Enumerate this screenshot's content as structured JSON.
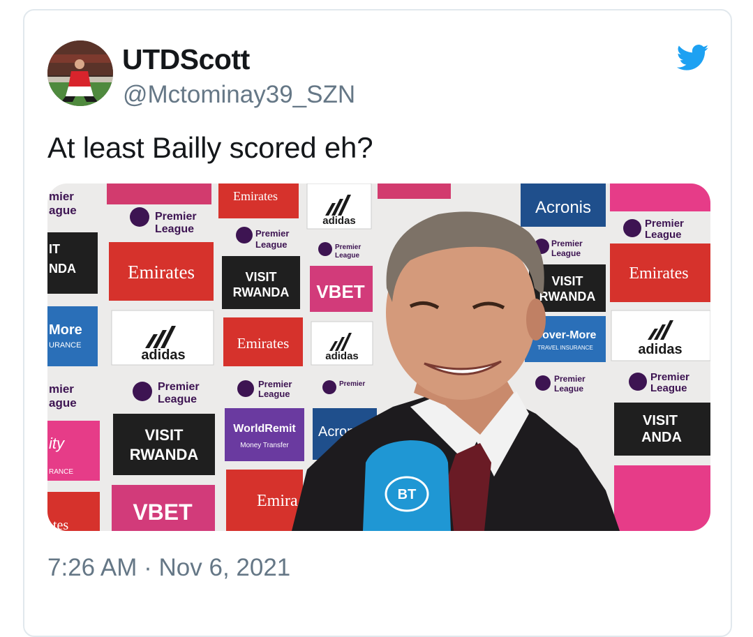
{
  "tweet": {
    "display_name": "UTDScott",
    "handle": "@Mctominay39_SZN",
    "text": "At least Bailly scored eh?",
    "timestamp": "7:26 AM · Nov 6, 2021"
  },
  "icons": {
    "logo": "twitter-bird-icon",
    "avatar": "profile-avatar",
    "brand_color": "#1da1f2"
  },
  "photo": {
    "board_texts": {
      "premier": "Premier",
      "league": "League",
      "emirates": "Emirates",
      "adidas": "adidas",
      "visit": "VISIT",
      "rwanda": "RWANDA",
      "vbet": "VBET",
      "acronis": "Acronis",
      "cover_more": "Cover-More",
      "travel_insurance": "TRAVEL INSURANCE",
      "worldremit": "WorldRemit",
      "money_transfer": "Money Transfer",
      "more": "More",
      "insurance": "URANCE",
      "bt": "BT"
    }
  }
}
